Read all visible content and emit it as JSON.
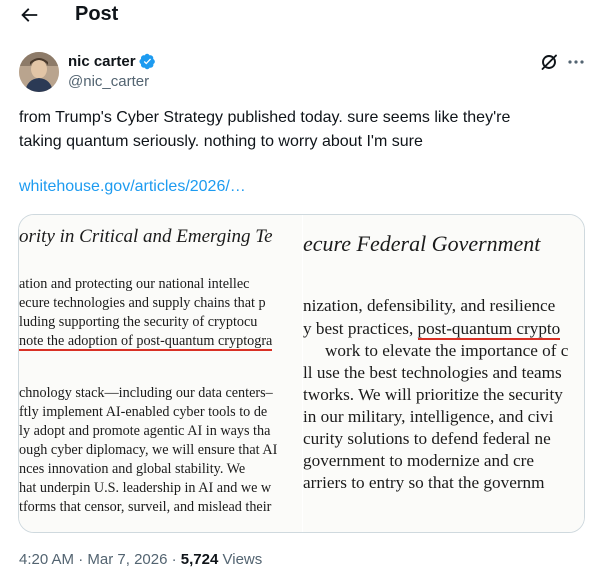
{
  "header": {
    "back_icon": "arrow-left-icon",
    "title": "Post"
  },
  "author": {
    "name": "nic carter",
    "handle": "@nic_carter",
    "verified_icon": "verified-badge-icon",
    "verified_color": "#1d9bf0"
  },
  "actions": {
    "grok_icon": "grok-slash-icon",
    "more_icon": "more-dots-icon"
  },
  "tweet": {
    "text_lines": [
      "from Trump's Cyber Strategy published today. sure seems like they're",
      "taking quantum seriously. nothing to worry about I'm sure"
    ],
    "link": "whitehouse.gov/articles/2026/…",
    "link_color": "#1d9bf0"
  },
  "media": {
    "left": {
      "title": "ority in Critical and Emerging Te",
      "lines": [
        "ation  and  protecting  our  national  intellec",
        "ecure technologies and supply chains that p",
        "luding  supporting  the  security  of  cryptocu",
        "note the adoption of post-quantum cryptogra",
        "chnology stack—including our data centers–",
        "ftly implement AI-enabled cyber tools to de",
        "ly adopt and promote agentic AI in ways tha",
        "ough cyber diplomacy, we will ensure that AI",
        "nces  innovation  and  global  stability.  We",
        "hat underpin U.S. leadership in AI and we w",
        "tforms that censor, surveil, and mislead their"
      ]
    },
    "right": {
      "title": "ecure Federal Government",
      "lines": [
        "nization, defensibility, and resilience",
        "y best practices, post-quantum crypto",
        "work to elevate the importance of c",
        "ll use the best technologies and teams",
        "tworks. We will prioritize the security",
        "in our military, intelligence, and civi",
        "curity solutions to defend federal ne",
        "government  to  modernize  and  cre",
        "arriers to entry so that the governm"
      ],
      "underlined_phrase": "post-quantum crypto"
    }
  },
  "meta": {
    "time": "4:20 AM",
    "separator": "·",
    "date": "Mar 7, 2026",
    "views_count": "5,724",
    "views_label": "Views"
  }
}
